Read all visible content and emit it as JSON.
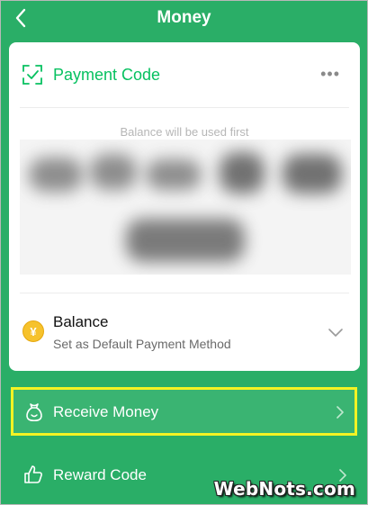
{
  "header": {
    "title": "Money"
  },
  "payment_code": {
    "title": "Payment Code",
    "more": "•••",
    "hint": "Balance will be used first"
  },
  "balance": {
    "icon_glyph": "¥",
    "title": "Balance",
    "subtitle": "Set as Default Payment Method"
  },
  "rows": {
    "receive_money": "Receive Money",
    "reward_code": "Reward Code"
  },
  "watermark": "WebNots.com",
  "colors": {
    "background": "#2aae67",
    "accent": "#07c160",
    "highlight": "#f3f324",
    "coin": "#f6c22c"
  },
  "icons": [
    "back-arrow-icon",
    "scan-check-icon",
    "more-icon",
    "yen-coin-icon",
    "chevron-down-icon",
    "money-bag-icon",
    "thumbs-up-icon",
    "chevron-right-icon"
  ]
}
